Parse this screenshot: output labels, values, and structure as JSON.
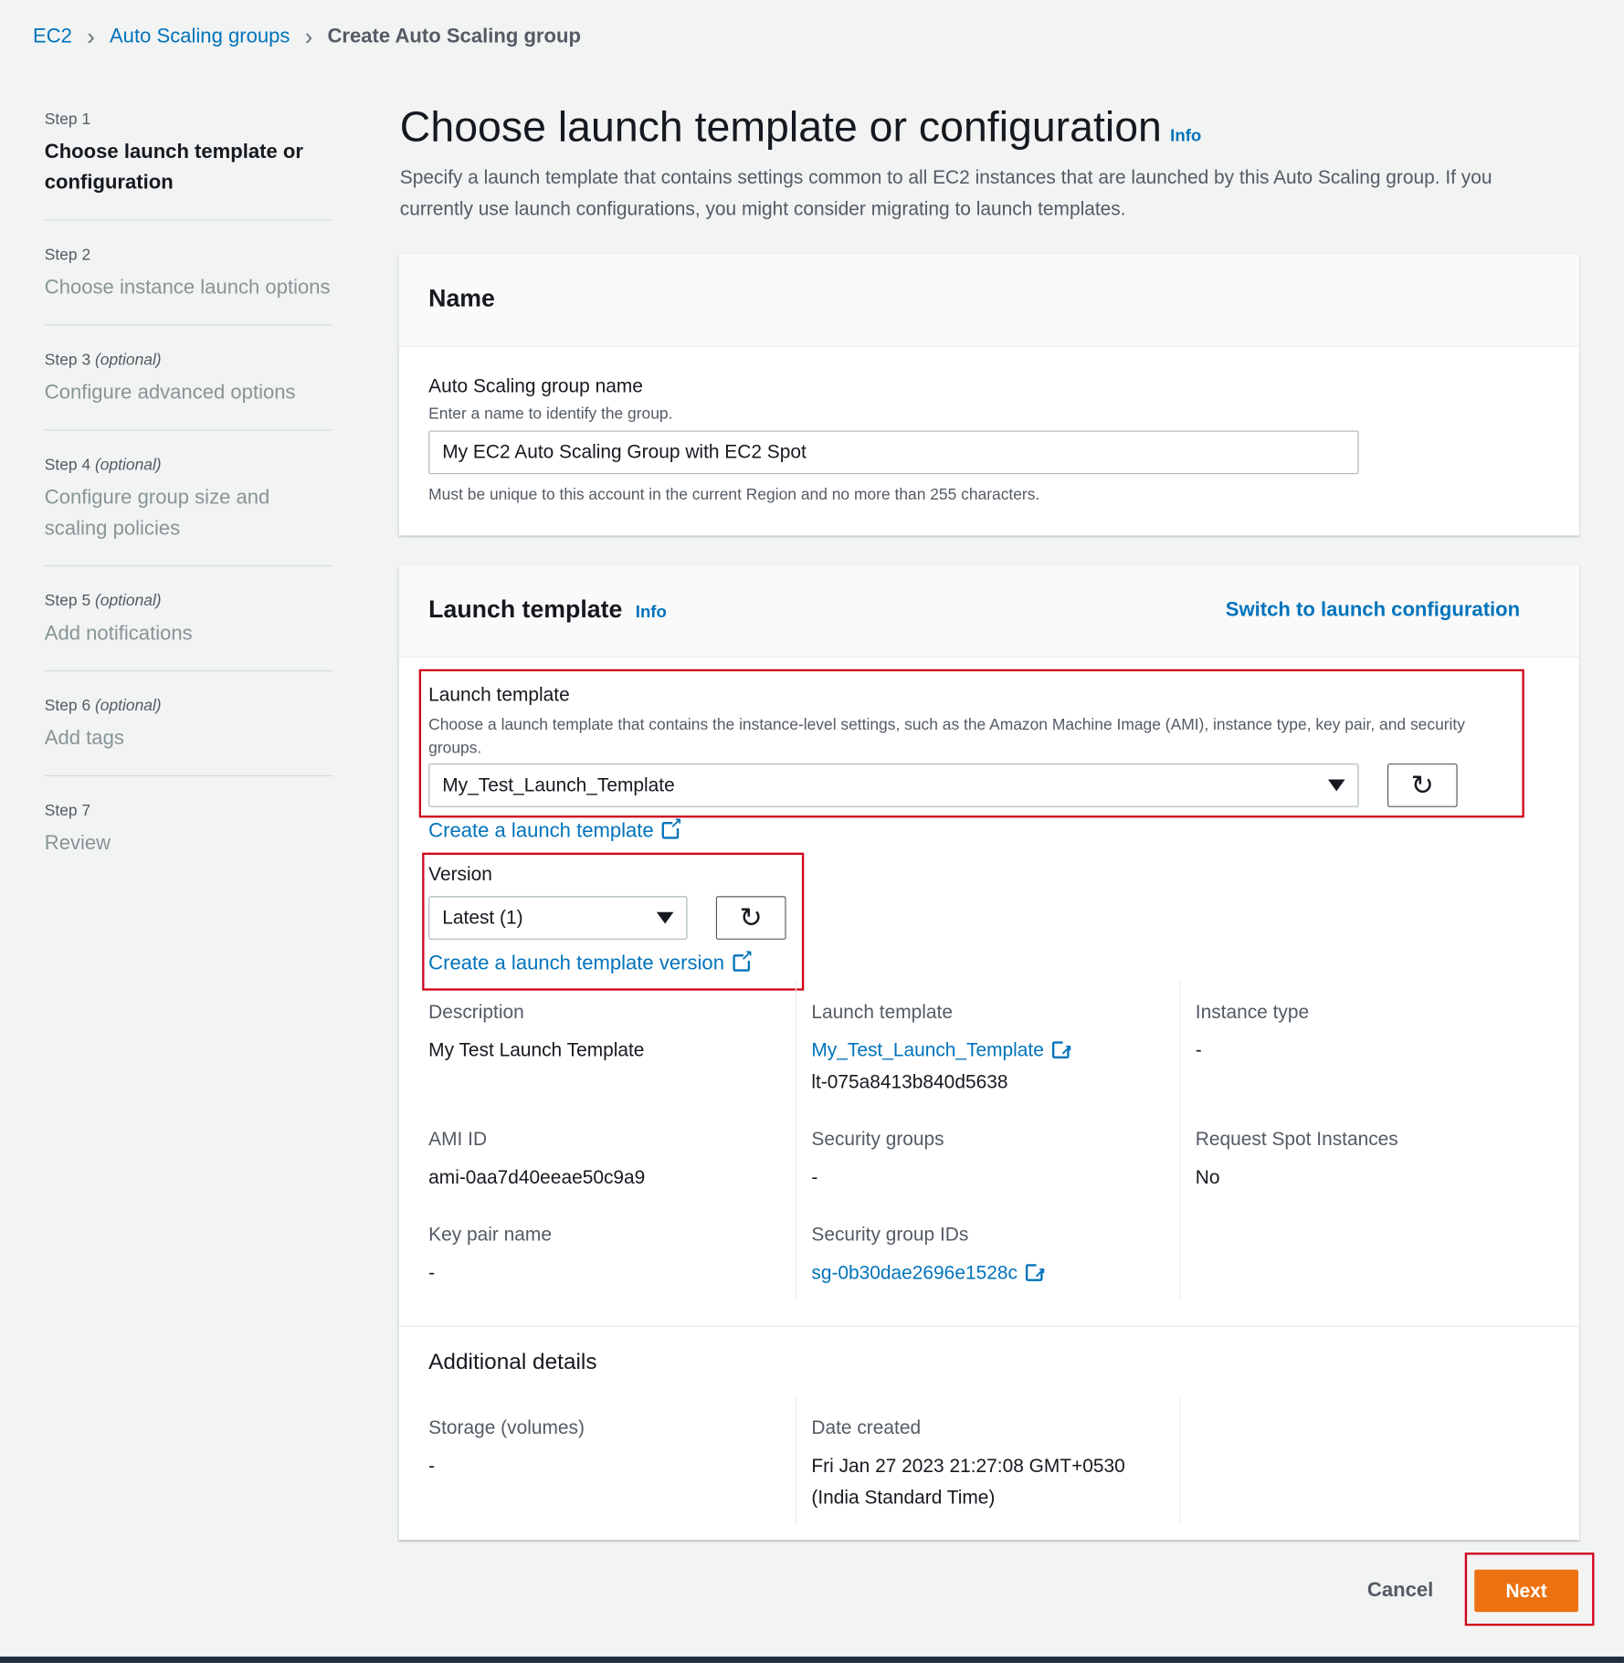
{
  "breadcrumb": [
    "EC2",
    "Auto Scaling groups",
    "Create Auto Scaling group"
  ],
  "steps": [
    {
      "step": "Step 1",
      "optional": "",
      "title": "Choose launch template or configuration"
    },
    {
      "step": "Step 2",
      "optional": "",
      "title": "Choose instance launch options"
    },
    {
      "step": "Step 3",
      "optional": "(optional)",
      "title": "Configure advanced options"
    },
    {
      "step": "Step 4",
      "optional": "(optional)",
      "title": "Configure group size and scaling policies"
    },
    {
      "step": "Step 5",
      "optional": "(optional)",
      "title": "Add notifications"
    },
    {
      "step": "Step 6",
      "optional": "(optional)",
      "title": "Add tags"
    },
    {
      "step": "Step 7",
      "optional": "",
      "title": "Review"
    }
  ],
  "page": {
    "title": "Choose launch template or configuration",
    "info": "Info",
    "description": "Specify a launch template that contains settings common to all EC2 instances that are launched by this Auto Scaling group. If you currently use launch configurations, you might consider migrating to launch templates."
  },
  "name_panel": {
    "title": "Name",
    "label": "Auto Scaling group name",
    "hint": "Enter a name to identify the group.",
    "value": "My EC2 Auto Scaling Group with EC2 Spot",
    "constraint": "Must be unique to this account in the current Region and no more than 255 characters."
  },
  "lt_panel": {
    "title": "Launch template",
    "info": "Info",
    "switch": "Switch to launch configuration",
    "label": "Launch template",
    "hint": "Choose a launch template that contains the instance-level settings, such as the Amazon Machine Image (AMI), instance type, key pair, and security groups.",
    "selected": "My_Test_Launch_Template",
    "create_link": "Create a launch template",
    "version_label": "Version",
    "version_selected": "Latest (1)",
    "create_version_link": "Create a launch template version"
  },
  "details": {
    "description": {
      "k": "Description",
      "v": "My Test Launch Template"
    },
    "launch_template": {
      "k": "Launch template",
      "v": "My_Test_Launch_Template",
      "id": "lt-075a8413b840d5638"
    },
    "instance_type": {
      "k": "Instance type",
      "v": "-"
    },
    "ami": {
      "k": "AMI ID",
      "v": "ami-0aa7d40eeae50c9a9"
    },
    "security_groups": {
      "k": "Security groups",
      "v": "-"
    },
    "spot": {
      "k": "Request Spot Instances",
      "v": "No"
    },
    "key_pair": {
      "k": "Key pair name",
      "v": "-"
    },
    "sg_ids": {
      "k": "Security group IDs",
      "v": "sg-0b30dae2696e1528c"
    }
  },
  "additional": {
    "title": "Additional details",
    "storage": {
      "k": "Storage (volumes)",
      "v": "-"
    },
    "date": {
      "k": "Date created",
      "v": "Fri Jan 27 2023 21:27:08 GMT+0530 (India Standard Time)"
    }
  },
  "footer": {
    "cancel": "Cancel",
    "next": "Next"
  },
  "colors": {
    "accent": "#ec7211",
    "link": "#0073bb",
    "highlight": "#d0021b"
  }
}
